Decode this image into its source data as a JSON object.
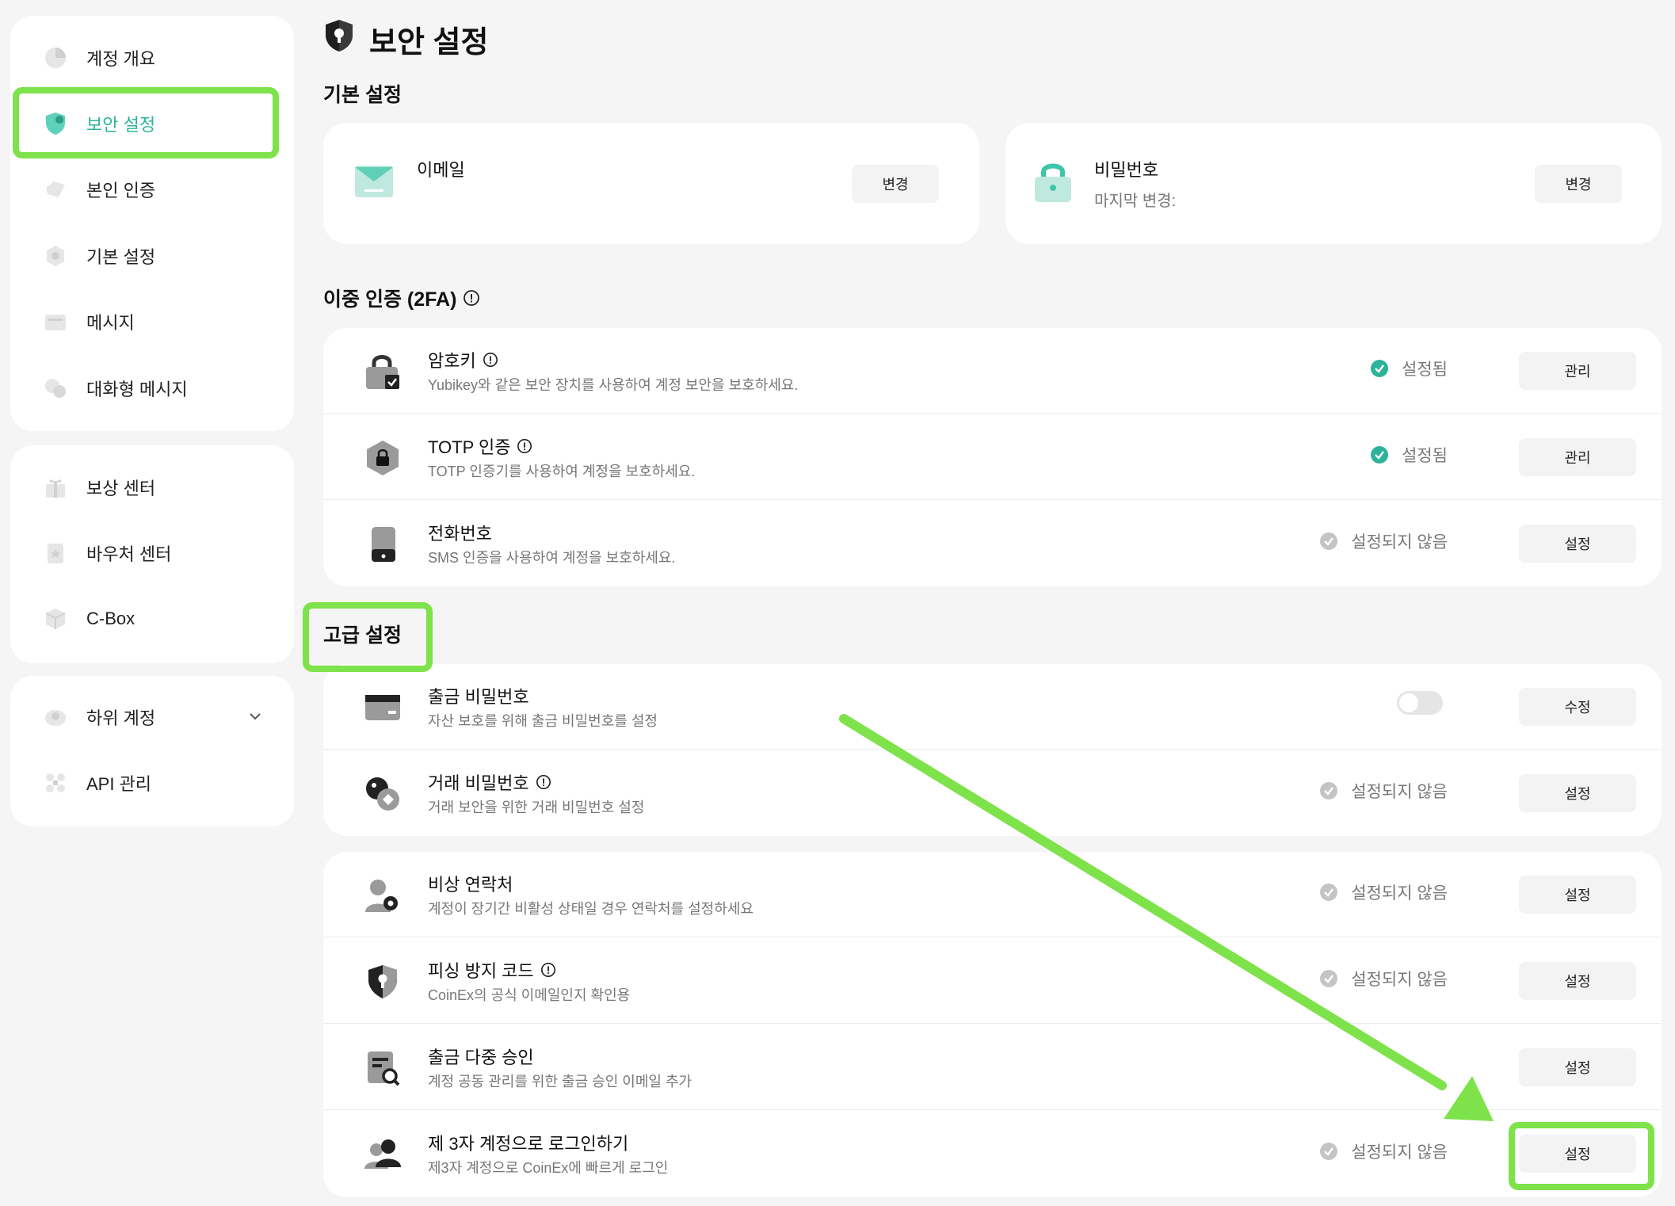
{
  "sidebar": {
    "group1": [
      {
        "label": "계정 개요",
        "icon": "pie-chart-icon"
      },
      {
        "label": "보안 설정",
        "icon": "shield-icon",
        "active": true
      },
      {
        "label": "본인 인증",
        "icon": "id-card-icon"
      },
      {
        "label": "기본 설정",
        "icon": "settings-icon"
      },
      {
        "label": "메시지",
        "icon": "message-icon"
      },
      {
        "label": "대화형 메시지",
        "icon": "chat-icon"
      }
    ],
    "group2": [
      {
        "label": "보상 센터",
        "icon": "gift-icon"
      },
      {
        "label": "바우처 센터",
        "icon": "voucher-icon"
      },
      {
        "label": "C-Box",
        "icon": "box-icon"
      }
    ],
    "group3": [
      {
        "label": "하위 계정",
        "icon": "sub-account-icon",
        "expandable": true
      },
      {
        "label": "API 관리",
        "icon": "api-icon"
      }
    ]
  },
  "page": {
    "title": "보안 설정"
  },
  "basic": {
    "title": "기본 설정",
    "email": {
      "label": "이메일",
      "button": "변경"
    },
    "password": {
      "label": "비밀번호",
      "last_changed": "마지막 변경:",
      "button": "변경"
    }
  },
  "twofa": {
    "title": "이중 인증 (2FA)",
    "rows": [
      {
        "title": "암호키",
        "info": true,
        "desc": "Yubikey와 같은 보안 장치를 사용하여 계정 보안을 보호하세요.",
        "status": "설정됨",
        "status_on": true,
        "button": "관리"
      },
      {
        "title": "TOTP 인증",
        "info": true,
        "desc": "TOTP 인증기를 사용하여 계정을 보호하세요.",
        "status": "설정됨",
        "status_on": true,
        "button": "관리"
      },
      {
        "title": "전화번호",
        "info": false,
        "desc": "SMS 인증을 사용하여 계정을 보호하세요.",
        "status": "설정되지 않음",
        "status_on": false,
        "button": "설정"
      }
    ]
  },
  "advanced": {
    "title": "고급 설정",
    "group1": [
      {
        "title": "출금 비밀번호",
        "info": false,
        "desc": "자산 보호를 위해 출금 비밀번호를 설정",
        "toggle": true,
        "button": "수정"
      },
      {
        "title": "거래 비밀번호",
        "info": true,
        "desc": "거래 보안을 위한 거래 비밀번호 설정",
        "status": "설정되지 않음",
        "button": "설정"
      }
    ],
    "group2": [
      {
        "title": "비상 연락처",
        "info": false,
        "desc": "계정이 장기간 비활성 상태일 경우 연락처를 설정하세요",
        "status": "설정되지 않음",
        "button": "설정"
      },
      {
        "title": "피싱 방지 코드",
        "info": true,
        "desc": "CoinEx의 공식 이메일인지 확인용",
        "status": "설정되지 않음",
        "button": "설정"
      },
      {
        "title": "출금 다중 승인",
        "info": false,
        "desc": "계정 공동 관리를 위한 출금 승인 이메일 추가",
        "button": "설정"
      },
      {
        "title": "제 3자 계정으로 로그인하기",
        "info": false,
        "desc": "제3자 계정으로 CoinEx에 빠르게 로그인",
        "status": "설정되지 않음",
        "button": "설정"
      }
    ]
  },
  "colors": {
    "accent": "#2db39a",
    "highlight": "#7ee24a",
    "background": "#f5f5f5"
  }
}
